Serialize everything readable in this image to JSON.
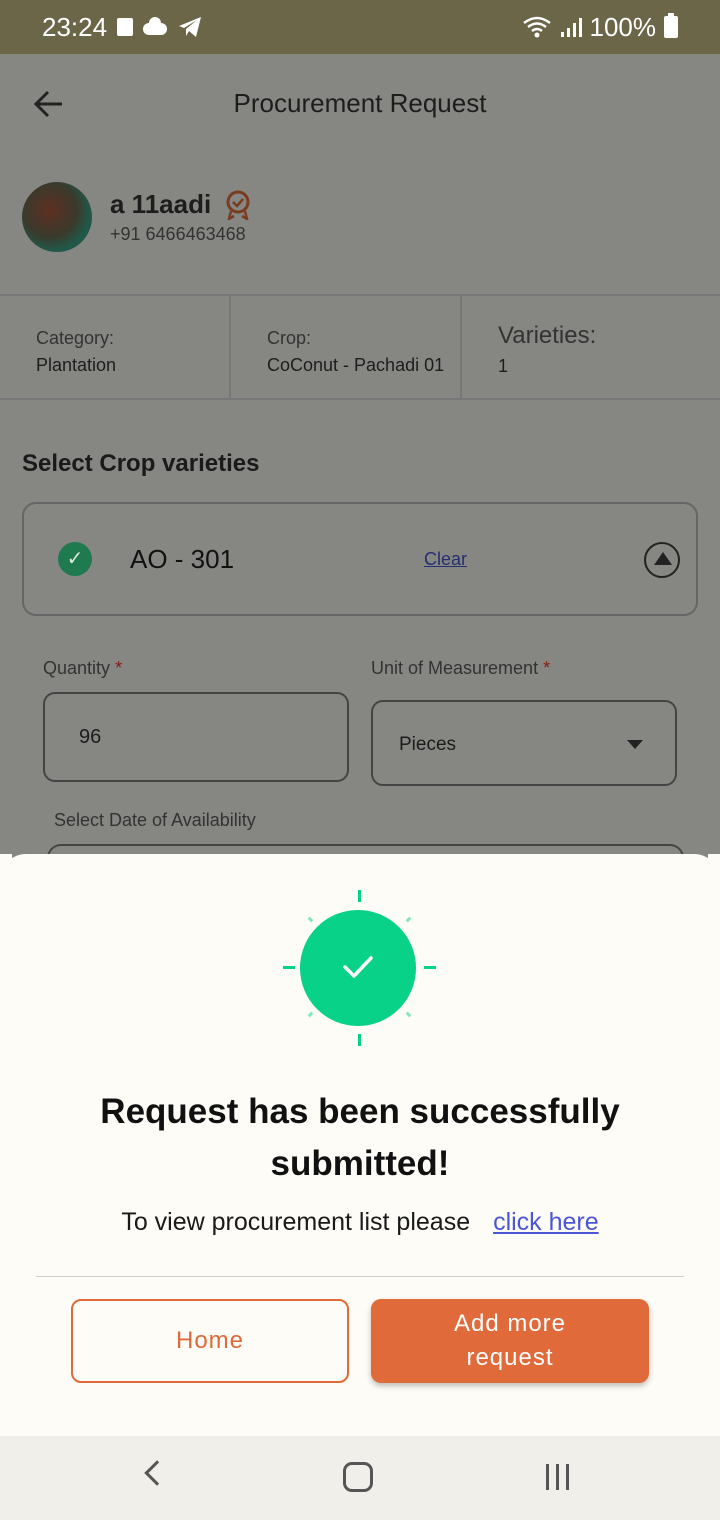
{
  "status_bar": {
    "time": "23:24",
    "battery": "100%",
    "icons": [
      "notification-square-icon",
      "cloud-icon",
      "telegram-icon",
      "wifi-icon",
      "signal-icon",
      "battery-icon"
    ]
  },
  "app_bar": {
    "title": "Procurement Request",
    "back_icon": "arrow-left-icon"
  },
  "profile": {
    "name": "a 11aadi",
    "phone": "+91 6466463468",
    "badge_icon": "award-badge-icon"
  },
  "info": {
    "category_label": "Category:",
    "category_value": "Plantation",
    "crop_label": "Crop:",
    "crop_value": "CoConut - Pachadi 01",
    "varieties_label": "Varieties:",
    "varieties_value": "1"
  },
  "varieties_section": {
    "title": "Select Crop varieties",
    "item_name": "AO - 301",
    "clear_label": "Clear"
  },
  "form": {
    "quantity_label": "Quantity",
    "quantity_value": "96",
    "uom_label": "Unit of Measurement",
    "uom_value": "Pieces",
    "required_mark": "*",
    "date_label": "Select Date of Availability"
  },
  "sheet": {
    "title_line1": "Request has been successfully",
    "title_line2": "submitted!",
    "view_text": "To view procurement list please",
    "view_link": "click here",
    "home_label": "Home",
    "more_label": "Add more request"
  },
  "colors": {
    "accent": "#e06a3a",
    "success": "#08d188",
    "status_bar": "#6b6648",
    "sheet_bg": "#fdfcf6"
  }
}
